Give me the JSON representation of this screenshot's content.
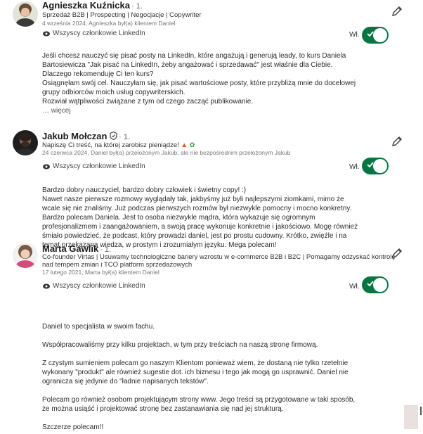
{
  "recommendations": [
    {
      "name": "Agnieszka Kuźnicka",
      "degree": "· 1.",
      "headline": "Sprzedaż B2B | Prospecting | Negocjacje | Copywriter",
      "date": "4 września 2024, Agnieszka był(a) klientem Daniel",
      "visibility": "Wszyscy członkowie LinkedIn",
      "toggle_label": "Wł.",
      "body": [
        "Jeśli chcesz nauczyć się pisać posty na LinkedIn, które angażują i generują leady, to kurs Daniela",
        "Bartosiewicza \"Jak pisać na LinkedIn, żeby angażować i sprzedawać\" jest właśnie dla Ciebie.",
        "Dlaczego rekomenduję Ci ten kurs?",
        "Osiągnęłam swój cel. Nauczyłam się, jak pisać wartościowe posty, które przybliżą mnie do docelowej",
        "grupy odbiorców moich usług copywriterskich.",
        "Rozwiał wątpliwości związane z tym od czego zacząć publikowanie."
      ],
      "more": "… więcej"
    },
    {
      "name": "Jakub Mołczan",
      "degree": "· 1.",
      "headline": "Napiszę Ci treść, na której zarobisz pieniądze!",
      "date": "24 czerwca 2024, Daniel był(a) przełożonym Jakub, ale nie bezpośrednim przełożonym Jakub",
      "visibility": "Wszyscy członkowie LinkedIn",
      "toggle_label": "Wł.",
      "body": [
        "Bardzo dobry nauczyciel, bardzo dobry człowiek i świetny copy! :)",
        "Nawet nasze pierwsze rozmowy wyglądały tak, jakbyśmy już byli najlepszymi ziomkami, mimo że",
        "wcale się nie znaliśmy. Już podczas pierwszych rozmów był niezwykle pomocny i mocno konkretny.",
        "Bardzo polecam Daniela. Jest to osoba niezwykle mądra, która wykazuje się ogromnym",
        "profesjonalizmem i zaangażowaniem, a swoją pracę wykonuje konkretnie i jakościowo. Mogę również",
        "śmiało powiedzieć, że podcast, który prowadzi daniel, jest po prostu cudowny. Krótko, zwięźle i na",
        "temat przekazana wiedza, w prostym i zrozumiałym języku. Mega polecam!"
      ]
    },
    {
      "name": "Marta Gawlik",
      "degree": "· 1.",
      "headline_line1": "Co-founder Virtas | Usuwamy technologiczne bariery wzrostu w e-commerce B2B i B2C | Pomagamy odzyskać kontrolę",
      "headline_line2": "nad tempem zmian i TCO platform sprzedażowych",
      "date": "17 lutego 2021, Marta był(a) klientem Daniel",
      "visibility": "Wszyscy członkowie LinkedIn",
      "toggle_label": "Wł.",
      "paragraphs": [
        [
          "Daniel to specjalista w swoim fachu."
        ],
        [
          "Współpracowaliśmy przy kilku projektach, w tym przy treściach na naszą stronę firmową."
        ],
        [
          "Z czystym sumieniem polecam go naszym Klientom ponieważ wiem, że dostaną nie tylko rzetelnie",
          "wykonany \"produkt\" ale również sugestie dot. ich biznesu i tego jak mogą go usprawnić. Daniel nie",
          "ogranicza się jedynie do \"ładnie napisanych tekstów\"."
        ],
        [
          "Polecam go również osobom projektującym strony www. Jego treści są przygotowane w taki sposób,",
          "że można usiąść i projektować stronę bez zastanawiania się nad jej strukturą."
        ],
        [
          "Szczerze polecam!!"
        ]
      ]
    }
  ],
  "icons": {
    "edit": "pencil-icon",
    "visibility": "eye-icon",
    "verified": "shield-icon"
  },
  "colors": {
    "toggle_on": "#057642",
    "text": "#1f1f1f"
  }
}
